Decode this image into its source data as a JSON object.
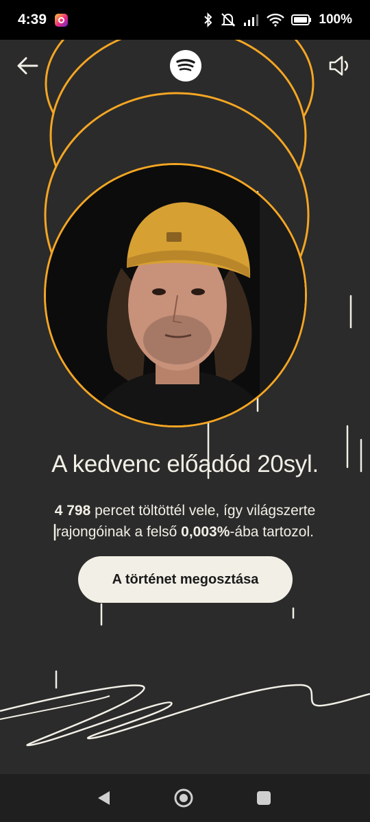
{
  "status_bar": {
    "time": "4:39",
    "battery": "100%",
    "icons": [
      "instagram-icon",
      "bluetooth-icon",
      "mute-icon",
      "signal-icon",
      "wifi-icon",
      "battery-icon"
    ]
  },
  "header": {
    "back_icon": "arrow-left-icon",
    "logo": "spotify-logo",
    "sound_icon": "speaker-icon"
  },
  "artist": {
    "image": "artist-portrait"
  },
  "headline": "A kedvenc előadód 20syl.",
  "stats": {
    "minutes": "4 798",
    "text_1": " percet töltöttél vele, így világszerte rajongóinak a felső ",
    "percent": "0,003%",
    "text_2": "-ába tartozol."
  },
  "share_button": "A történet megosztása",
  "colors": {
    "background": "#2b2b2b",
    "accent_ring": "#f5a623",
    "text": "#f2efe6",
    "button_bg": "#f2efe6"
  },
  "nav_bar": {
    "icons": [
      "nav-back-icon",
      "nav-home-icon",
      "nav-recents-icon"
    ]
  }
}
